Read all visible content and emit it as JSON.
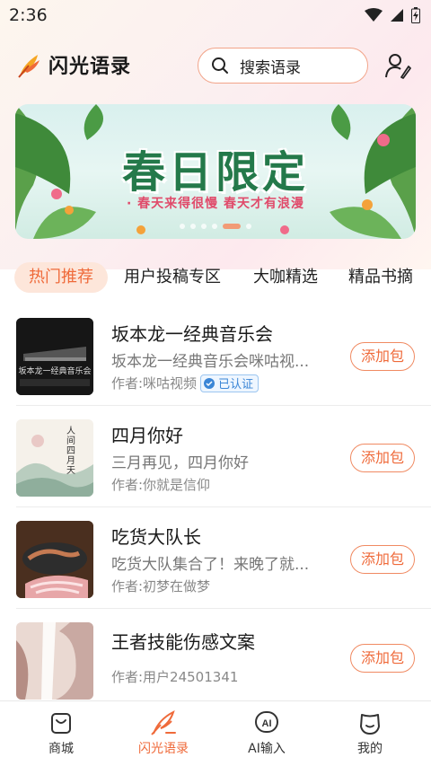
{
  "status_bar": {
    "time": "2:36"
  },
  "header": {
    "app_name": "闪光语录",
    "search_placeholder": "搜索语录"
  },
  "banner": {
    "title": "春日限定",
    "subtitle": "· 春天来得很慢 春天才有浪漫",
    "dot_count": 6,
    "active_dot": 4
  },
  "tabs": [
    {
      "label": "热门推荐",
      "active": true
    },
    {
      "label": "用户投稿专区",
      "active": false
    },
    {
      "label": "大咖精选",
      "active": false
    },
    {
      "label": "精品书摘",
      "active": false
    }
  ],
  "list": [
    {
      "title": "坂本龙一经典音乐会",
      "desc": "坂本龙一经典音乐会咪咕视...",
      "author": "作者:咪咕视频",
      "verified": "已认证",
      "action": "添加包",
      "thumb_caption": "坂本龙一经典音乐会"
    },
    {
      "title": "四月你好",
      "desc": "三月再见，四月你好",
      "author": "作者:你就是信仰",
      "action": "添加包",
      "thumb_caption": "人间四月天"
    },
    {
      "title": "吃货大队长",
      "desc": "吃货大队集合了！来晚了就...",
      "author": "作者:初梦在做梦",
      "action": "添加包"
    },
    {
      "title": "王者技能伤感文案",
      "desc": "",
      "author": "作者:用户24501341",
      "action": "添加包"
    }
  ],
  "bottom_nav": [
    {
      "label": "商城",
      "icon": "shop-bag-icon",
      "active": false
    },
    {
      "label": "闪光语录",
      "icon": "feather-pen-icon",
      "active": true
    },
    {
      "label": "AI输入",
      "icon": "ai-icon",
      "active": false
    },
    {
      "label": "我的",
      "icon": "smile-face-icon",
      "active": false
    }
  ],
  "colors": {
    "accent": "#ef6a3a",
    "tab_active_bg": "#fde6da",
    "verified": "#3b86d6",
    "banner_title": "#24794a"
  }
}
